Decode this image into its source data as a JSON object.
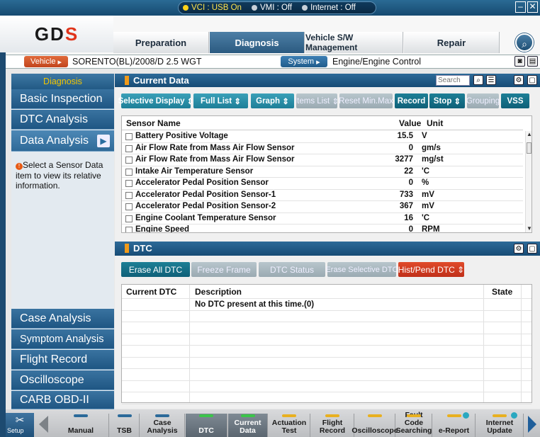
{
  "status_bar": {
    "vci": "VCI : USB On",
    "vmi": "VMI : Off",
    "internet": "Internet : Off"
  },
  "logo": {
    "text": "GDS"
  },
  "tabs": [
    {
      "label": "Preparation"
    },
    {
      "label": "Diagnosis"
    },
    {
      "label": "Vehicle S/W Management"
    },
    {
      "label": "Repair"
    }
  ],
  "vehicle": {
    "button": "Vehicle",
    "value": "SORENTO(BL)/2008/D 2.5 WGT",
    "system_button": "System",
    "system_value": "Engine/Engine Control"
  },
  "sidebar": {
    "header": "Diagnosis",
    "items": [
      "Basic Inspection",
      "DTC Analysis",
      "Data Analysis"
    ],
    "info_text": "Select a Sensor Data item to view its relative information.",
    "bottom_items": [
      "Case Analysis",
      "Symptom Analysis",
      "Flight Record",
      "Oscilloscope",
      "CARB OBD-II"
    ]
  },
  "current_data": {
    "title": "Current Data",
    "search_placeholder": "Search",
    "buttons": [
      "Selective Display",
      "Full List",
      "Graph",
      "Items List",
      "Reset Min.Max",
      "Record",
      "Stop",
      "Grouping",
      "VSS"
    ],
    "columns": {
      "name": "Sensor Name",
      "value": "Value",
      "unit": "Unit"
    },
    "rows": [
      {
        "name": "Battery Positive Voltage",
        "value": "15.5",
        "unit": "V"
      },
      {
        "name": "Air Flow Rate from Mass Air Flow Sensor",
        "value": "0",
        "unit": "gm/s"
      },
      {
        "name": "Air Flow Rate from Mass Air Flow Sensor",
        "value": "3277",
        "unit": "mg/st"
      },
      {
        "name": "Intake Air Temperature Sensor",
        "value": "22",
        "unit": "'C"
      },
      {
        "name": "Accelerator Pedal Position Sensor",
        "value": "0",
        "unit": "%"
      },
      {
        "name": "Accelerator Pedal Position Sensor-1",
        "value": "733",
        "unit": "mV"
      },
      {
        "name": "Accelerator Pedal Position Sensor-2",
        "value": "367",
        "unit": "mV"
      },
      {
        "name": "Engine Coolant Temperature Sensor",
        "value": "16",
        "unit": "'C"
      },
      {
        "name": "Engine Speed",
        "value": "0",
        "unit": "RPM"
      }
    ]
  },
  "dtc": {
    "title": "DTC",
    "buttons": [
      "Erase All DTC",
      "Freeze Frame",
      "DTC Status",
      "Erase Selective DTC",
      "Hist/Pend DTC"
    ],
    "columns": {
      "code": "Current DTC",
      "description": "Description",
      "state": "State"
    },
    "message": "No DTC present at this time.(0)"
  },
  "footer": {
    "setup": "Setup",
    "buttons": [
      "Manual",
      "TSB",
      "Case Analysis",
      "DTC",
      "Current Data",
      "Actuation Test",
      "Flight Record",
      "Oscilloscope",
      "Fault Code Searching",
      "e-Report",
      "Internet Update"
    ]
  }
}
